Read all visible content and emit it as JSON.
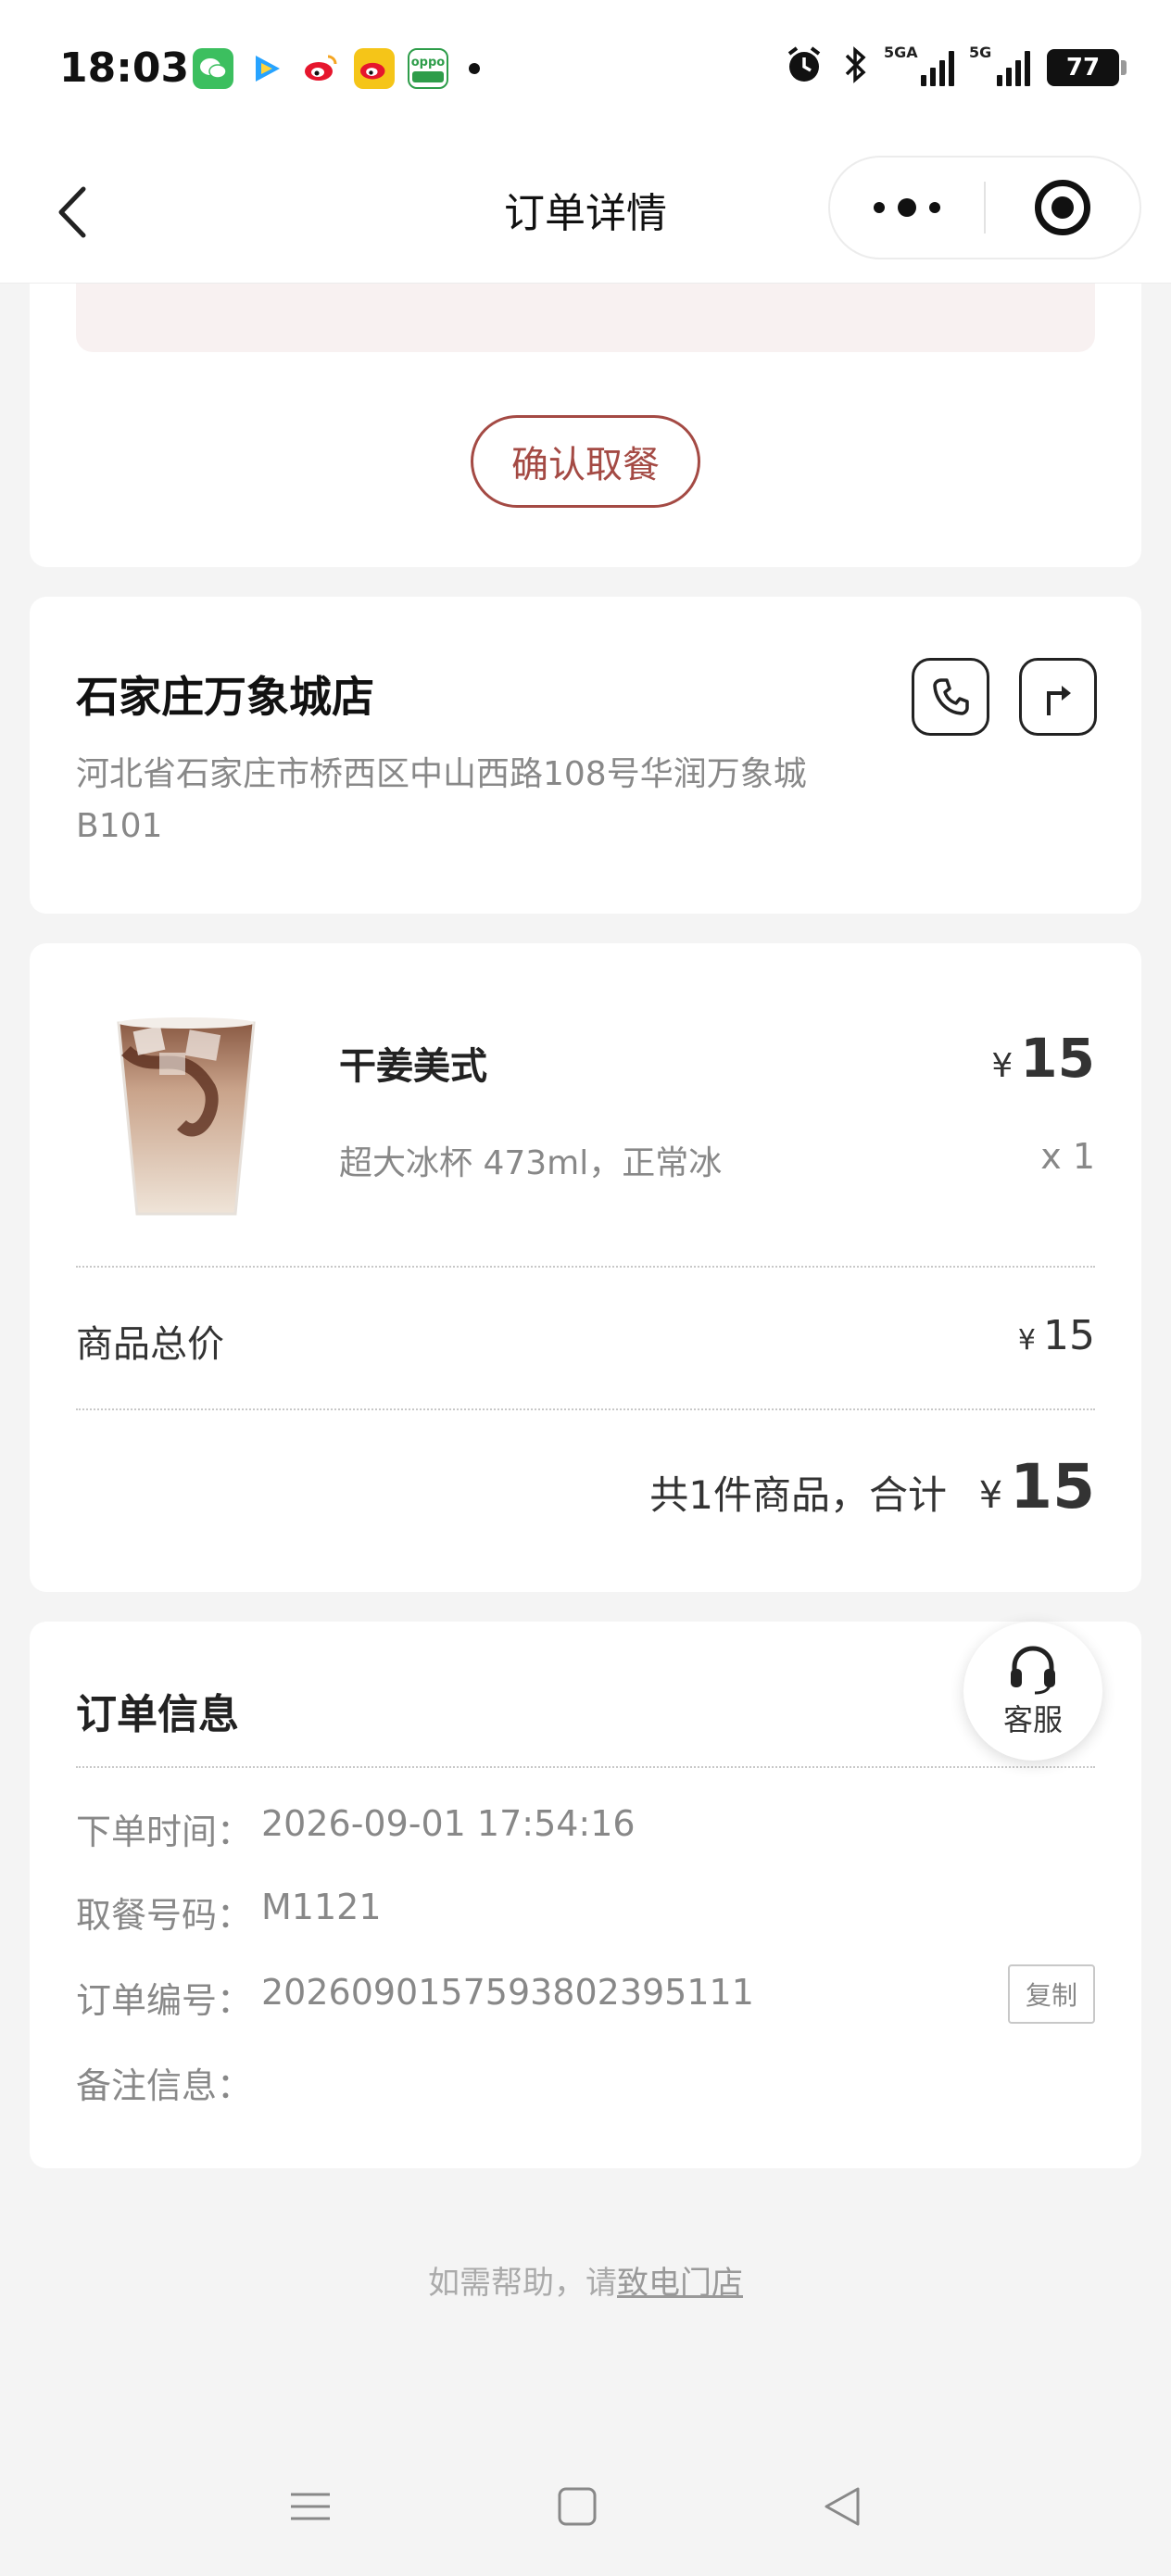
{
  "status_bar": {
    "time": "18:03",
    "notifications": [
      "wechat-icon",
      "tencent-video-icon",
      "weibo-icon",
      "weibo-icon",
      "oppo-icon"
    ],
    "oppo_label": "oppo",
    "battery": "77",
    "signal_1": "5GA",
    "signal_2": "5G"
  },
  "nav": {
    "title": "订单详情"
  },
  "pickup": {
    "confirm_label": "确认取餐"
  },
  "store": {
    "name": "石家庄万象城店",
    "address": "河北省石家庄市桥西区中山西路108号华润万象城B101"
  },
  "items": [
    {
      "name": "干姜美式",
      "spec": "超大冰杯 473ml，正常冰",
      "currency": "¥",
      "price": "15",
      "qty": "x 1"
    }
  ],
  "summary": {
    "subtotal_label": "商品总价",
    "currency": "¥",
    "subtotal_value": "15",
    "total_label": "共1件商品，合计",
    "total_value": "15"
  },
  "order_info": {
    "title": "订单信息",
    "rows": [
      {
        "label": "下单时间：",
        "value": "2026-09-01 17:54:16"
      },
      {
        "label": "取餐号码：",
        "value": "M1121"
      },
      {
        "label": "订单编号：",
        "value": "202609015759380239511 1"
      },
      {
        "label": "备注信息：",
        "value": ""
      }
    ],
    "copy_label": "复制"
  },
  "service": {
    "label": "客服"
  },
  "help": {
    "prefix": "如需帮助，请",
    "link": "致电门店"
  },
  "colors": {
    "accent": "#a44a44",
    "page_bg": "#f4f4f4",
    "strip_bg": "#f8f1f1"
  }
}
